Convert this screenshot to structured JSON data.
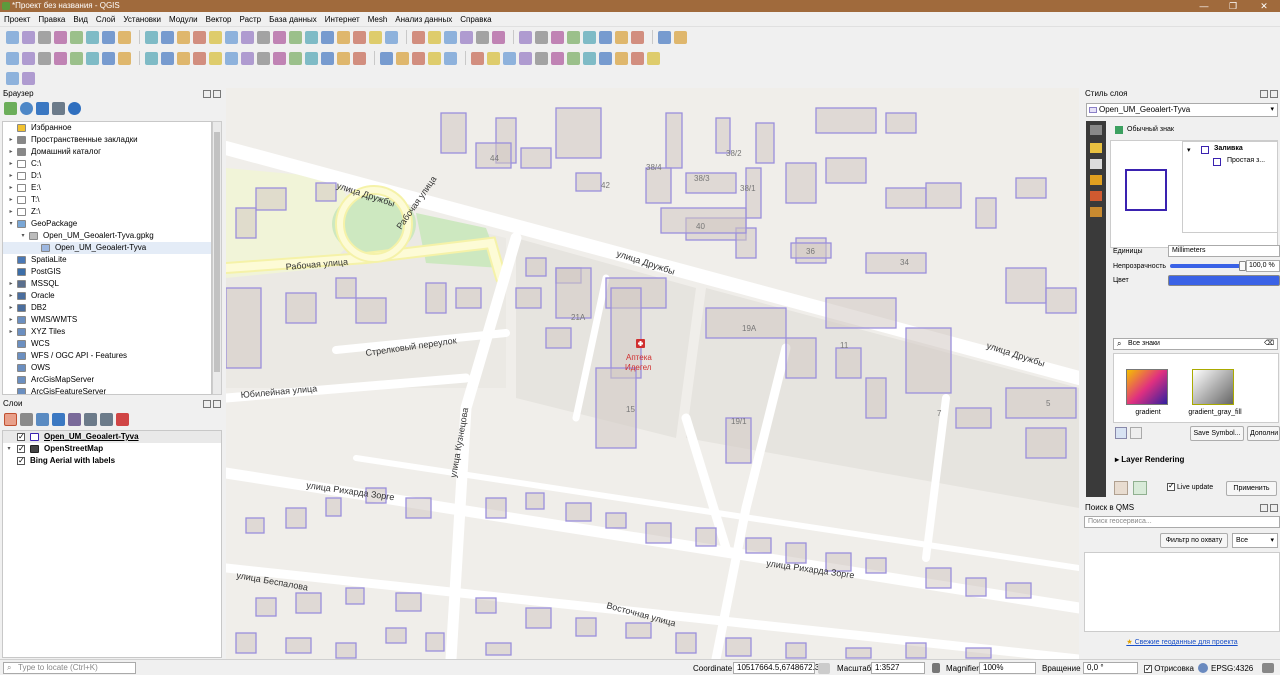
{
  "window": {
    "title": "*Проект без названия - QGIS",
    "controls": [
      "—",
      "❐",
      "✕"
    ]
  },
  "menu": [
    "Проект",
    "Правка",
    "Вид",
    "Слой",
    "Установки",
    "Модули",
    "Вектор",
    "Растр",
    "База данных",
    "Интернет",
    "Mesh",
    "Анализ данных",
    "Справка"
  ],
  "browser": {
    "title": "Браузер",
    "items": [
      {
        "label": "Избранное",
        "arrow": "",
        "icon": "star-icon",
        "color": "#f2c230",
        "indent": 0
      },
      {
        "label": "Пространственные закладки",
        "arrow": "▸",
        "icon": "bookmark-icon",
        "color": "#888888",
        "indent": 0
      },
      {
        "label": "Домашний каталог",
        "arrow": "▸",
        "icon": "home-icon",
        "color": "#888888",
        "indent": 0
      },
      {
        "label": "C:\\",
        "arrow": "▸",
        "icon": "folder-icon",
        "color": "#ffffff",
        "indent": 0
      },
      {
        "label": "D:\\",
        "arrow": "▸",
        "icon": "folder-icon",
        "color": "#ffffff",
        "indent": 0
      },
      {
        "label": "E:\\",
        "arrow": "▸",
        "icon": "folder-icon",
        "color": "#ffffff",
        "indent": 0
      },
      {
        "label": "T:\\",
        "arrow": "▸",
        "icon": "folder-icon",
        "color": "#ffffff",
        "indent": 0
      },
      {
        "label": "Z:\\",
        "arrow": "▸",
        "icon": "folder-icon",
        "color": "#ffffff",
        "indent": 0
      },
      {
        "label": "GeoPackage",
        "arrow": "▾",
        "icon": "geopackage-icon",
        "color": "#7aa7d6",
        "indent": 0
      },
      {
        "label": "Open_UM_Geoalert-Tyva.gpkg",
        "arrow": "▾",
        "icon": "gpkg-file-icon",
        "color": "#bbbbbb",
        "indent": 1
      },
      {
        "label": "Open_UM_Geoalert-Tyva",
        "arrow": "",
        "icon": "polygon-layer-icon",
        "color": "#9db7e0",
        "indent": 2
      },
      {
        "label": "SpatiaLite",
        "arrow": "",
        "icon": "spatialite-icon",
        "color": "#4a78b5",
        "indent": 0
      },
      {
        "label": "PostGIS",
        "arrow": "",
        "icon": "postgis-icon",
        "color": "#3c6ea8",
        "indent": 0
      },
      {
        "label": "MSSQL",
        "arrow": "▸",
        "icon": "mssql-icon",
        "color": "#5a6f8e",
        "indent": 0
      },
      {
        "label": "Oracle",
        "arrow": "▸",
        "icon": "oracle-icon",
        "color": "#4b6e9e",
        "indent": 0
      },
      {
        "label": "DB2",
        "arrow": "▸",
        "icon": "db2-icon",
        "color": "#4b6e9e",
        "indent": 0
      },
      {
        "label": "WMS/WMTS",
        "arrow": "▸",
        "icon": "wms-icon",
        "color": "#6b8fc0",
        "indent": 0
      },
      {
        "label": "XYZ Tiles",
        "arrow": "▸",
        "icon": "xyz-icon",
        "color": "#6b8fc0",
        "indent": 0
      },
      {
        "label": "WCS",
        "arrow": "",
        "icon": "wcs-icon",
        "color": "#6b8fc0",
        "indent": 0
      },
      {
        "label": "WFS / OGC API - Features",
        "arrow": "",
        "icon": "wfs-icon",
        "color": "#6b8fc0",
        "indent": 0
      },
      {
        "label": "OWS",
        "arrow": "",
        "icon": "ows-icon",
        "color": "#6b8fc0",
        "indent": 0
      },
      {
        "label": "ArcGisMapServer",
        "arrow": "",
        "icon": "arcgis-icon",
        "color": "#6b8fc0",
        "indent": 0
      },
      {
        "label": "ArcGisFeatureServer",
        "arrow": "",
        "icon": "arcgis-icon",
        "color": "#6b8fc0",
        "indent": 0
      }
    ]
  },
  "layers": {
    "title": "Слои",
    "items": [
      {
        "label": "Open_UM_Geoalert-Tyva",
        "arrow": "",
        "checked": true,
        "icon": "polygon-symbol-icon",
        "underline": true
      },
      {
        "label": "OpenStreetMap",
        "arrow": "▾",
        "checked": true,
        "icon": "xyz-layer-icon",
        "underline": false
      },
      {
        "label": "Bing Aerial with labels",
        "arrow": "",
        "checked": true,
        "icon": "",
        "underline": false
      }
    ]
  },
  "map": {
    "streets": [
      "улица Дружбы",
      "Рабочая улица",
      "Рабочая улица",
      "улица Дружбы",
      "Стрелковый переулок",
      "Юбилейная улица",
      "улица Кузнецова",
      "улица Рихарда Зорге",
      "улица Рихарда Зорге",
      "улица Беспалова",
      "Восточная улица",
      "улица Дружбы"
    ],
    "house_numbers": [
      "44",
      "42",
      "38/4",
      "38/2",
      "38/3",
      "38/1",
      "40",
      "36",
      "34",
      "21А",
      "19А",
      "11",
      "15",
      "19/1",
      "7",
      "5"
    ],
    "poi": {
      "name": "Аптека",
      "name2": "Идегел",
      "color": "#d03030"
    },
    "building_stroke": "#9b8fdc"
  },
  "style_panel": {
    "title": "Стиль слоя",
    "layer": "Open_UM_Geoalert-Tyva",
    "renderer": "Обычный знак",
    "tree_fill": "Заливка",
    "tree_simple": "Простая з...",
    "units_label": "Единицы",
    "units_value": "Millimeters",
    "opacity_label": "Непрозрачность",
    "opacity_value": "100,0 %",
    "opacity": 1.0,
    "color_label": "Цвет",
    "color": "#3a62e6",
    "search_placeholder": "Все знаки",
    "symbols": [
      "gradient",
      "gradient_gray_fill"
    ],
    "save_symbol": "Save Symbol...",
    "more": "Дополни",
    "layer_rendering": "Layer Rendering",
    "live_update": "Live update",
    "apply": "Применить"
  },
  "qms": {
    "title": "Поиск в QMS",
    "search_placeholder": "Поиск геосервиса...",
    "filter": "Фильтр по охвату",
    "filter_value": "Все",
    "link": "Свежие геоданные для проекта"
  },
  "status": {
    "locate_placeholder": "Type to locate (Ctrl+K)",
    "coordinate_label": "Coordinate",
    "coordinate": "10517664.5,6748672.3",
    "scale_label": "Масштаб",
    "scale": "1:3527",
    "magnifier_label": "Magnifier",
    "magnifier": "100%",
    "rotation_label": "Вращение",
    "rotation": "0,0 °",
    "render_label": "Отрисовка",
    "crs": "EPSG:4326"
  }
}
